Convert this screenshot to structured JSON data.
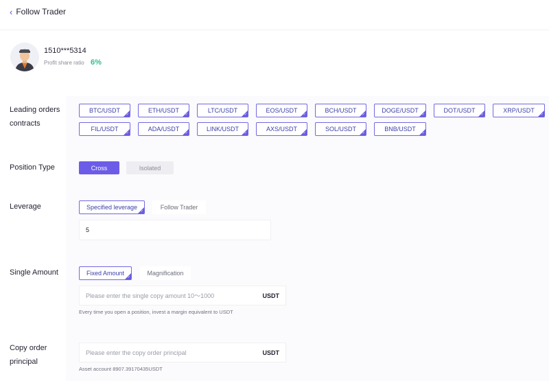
{
  "header": {
    "back_icon": "chevron-left-icon",
    "title": "Follow Trader"
  },
  "trader": {
    "name": "1510***5314",
    "profit_share_label": "Profit share ratio",
    "profit_share_value": "6%",
    "avatar_icon": "trader-avatar-icon"
  },
  "leading_contracts": {
    "label_line1": "Leading orders",
    "label_line2": "contracts",
    "items": [
      "BTC/USDT",
      "ETH/USDT",
      "LTC/USDT",
      "EOS/USDT",
      "BCH/USDT",
      "DOGE/USDT",
      "DOT/USDT",
      "XRP/USDT",
      "FIL/USDT",
      "ADA/USDT",
      "LINK/USDT",
      "AXS/USDT",
      "SOL/USDT",
      "BNB/USDT"
    ]
  },
  "position_type": {
    "label": "Position Type",
    "options": [
      "Cross",
      "Isolated"
    ],
    "selected": "Cross"
  },
  "leverage": {
    "label": "Leverage",
    "options": [
      "Specified leverage",
      "Follow Trader"
    ],
    "selected": "Specified leverage",
    "value": "5"
  },
  "single_amount": {
    "label": "Single Amount",
    "options": [
      "Fixed Amount",
      "Magnification"
    ],
    "selected": "Fixed Amount",
    "placeholder": "Please enter the single copy amount 10～1000",
    "unit": "USDT",
    "hint": "Every time you open a position, invest a margin equivalent to USDT"
  },
  "copy_principal": {
    "label_line1": "Copy order",
    "label_line2": "principal",
    "placeholder": "Please enter the copy order principal",
    "unit": "USDT",
    "hint": "Asset account 8907.39170435USDT"
  },
  "colors": {
    "accent": "#6c5ce7",
    "profit": "#2fbf8f",
    "chip_border": "#7267e0"
  }
}
